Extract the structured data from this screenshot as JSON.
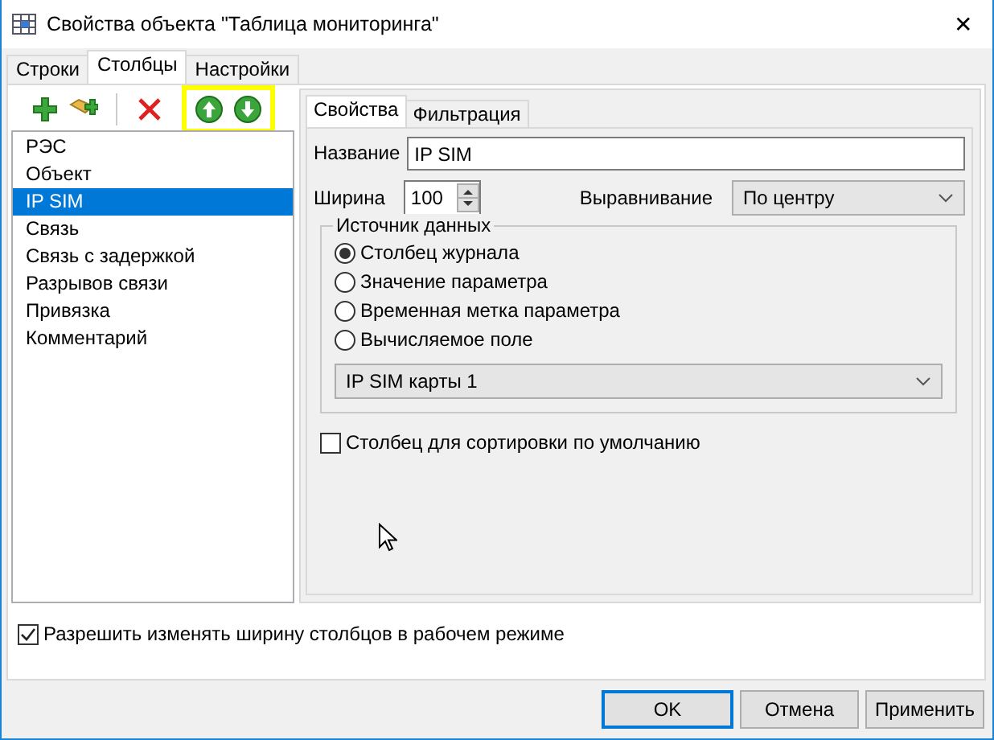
{
  "window": {
    "title": "Свойства объекта \"Таблица мониторинга\"",
    "close": "✕"
  },
  "tabs": [
    {
      "label": "Строки",
      "selected": false
    },
    {
      "label": "Столбцы",
      "selected": true
    },
    {
      "label": "Настройки",
      "selected": false
    }
  ],
  "toolbar": {
    "groups": [
      {
        "highlighted": false,
        "buttons": [
          {
            "kind": "add"
          },
          {
            "kind": "add-folder"
          }
        ]
      },
      {
        "highlighted": false,
        "buttons": [
          {
            "kind": "delete"
          }
        ]
      },
      {
        "highlighted": true,
        "buttons": [
          {
            "kind": "up"
          },
          {
            "kind": "down"
          }
        ]
      }
    ]
  },
  "columns": [
    {
      "label": "РЭС",
      "selected": false
    },
    {
      "label": "Объект",
      "selected": false
    },
    {
      "label": "IP SIM",
      "selected": true
    },
    {
      "label": "Связь",
      "selected": false
    },
    {
      "label": "Связь с задержкой",
      "selected": false
    },
    {
      "label": "Разрывов связи",
      "selected": false
    },
    {
      "label": "Привязка",
      "selected": false
    },
    {
      "label": "Комментарий",
      "selected": false
    }
  ],
  "inner_tabs": [
    {
      "label": "Свойства",
      "selected": true
    },
    {
      "label": "Фильтрация",
      "selected": false
    }
  ],
  "properties": {
    "name_label": "Название",
    "name_value": "IP SIM",
    "width_label": "Ширина",
    "width_value": "100",
    "align_label": "Выравнивание",
    "align_value": "По центру",
    "source": {
      "legend": "Источник данных",
      "options": [
        {
          "label": "Столбец журнала",
          "selected": true
        },
        {
          "label": "Значение параметра",
          "selected": false
        },
        {
          "label": "Временная метка параметра",
          "selected": false
        },
        {
          "label": "Вычисляемое поле",
          "selected": false
        }
      ],
      "select_value": "IP SIM карты 1"
    },
    "default_sort": {
      "label": "Столбец для сортировки по умолчанию",
      "checked": false
    }
  },
  "allow_resize": {
    "label": "Разрешить изменять ширину столбцов в рабочем режиме",
    "checked": true
  },
  "buttons": [
    {
      "label": "OK",
      "default": true
    },
    {
      "label": "Отмена",
      "default": false
    },
    {
      "label": "Применить",
      "default": false
    }
  ]
}
